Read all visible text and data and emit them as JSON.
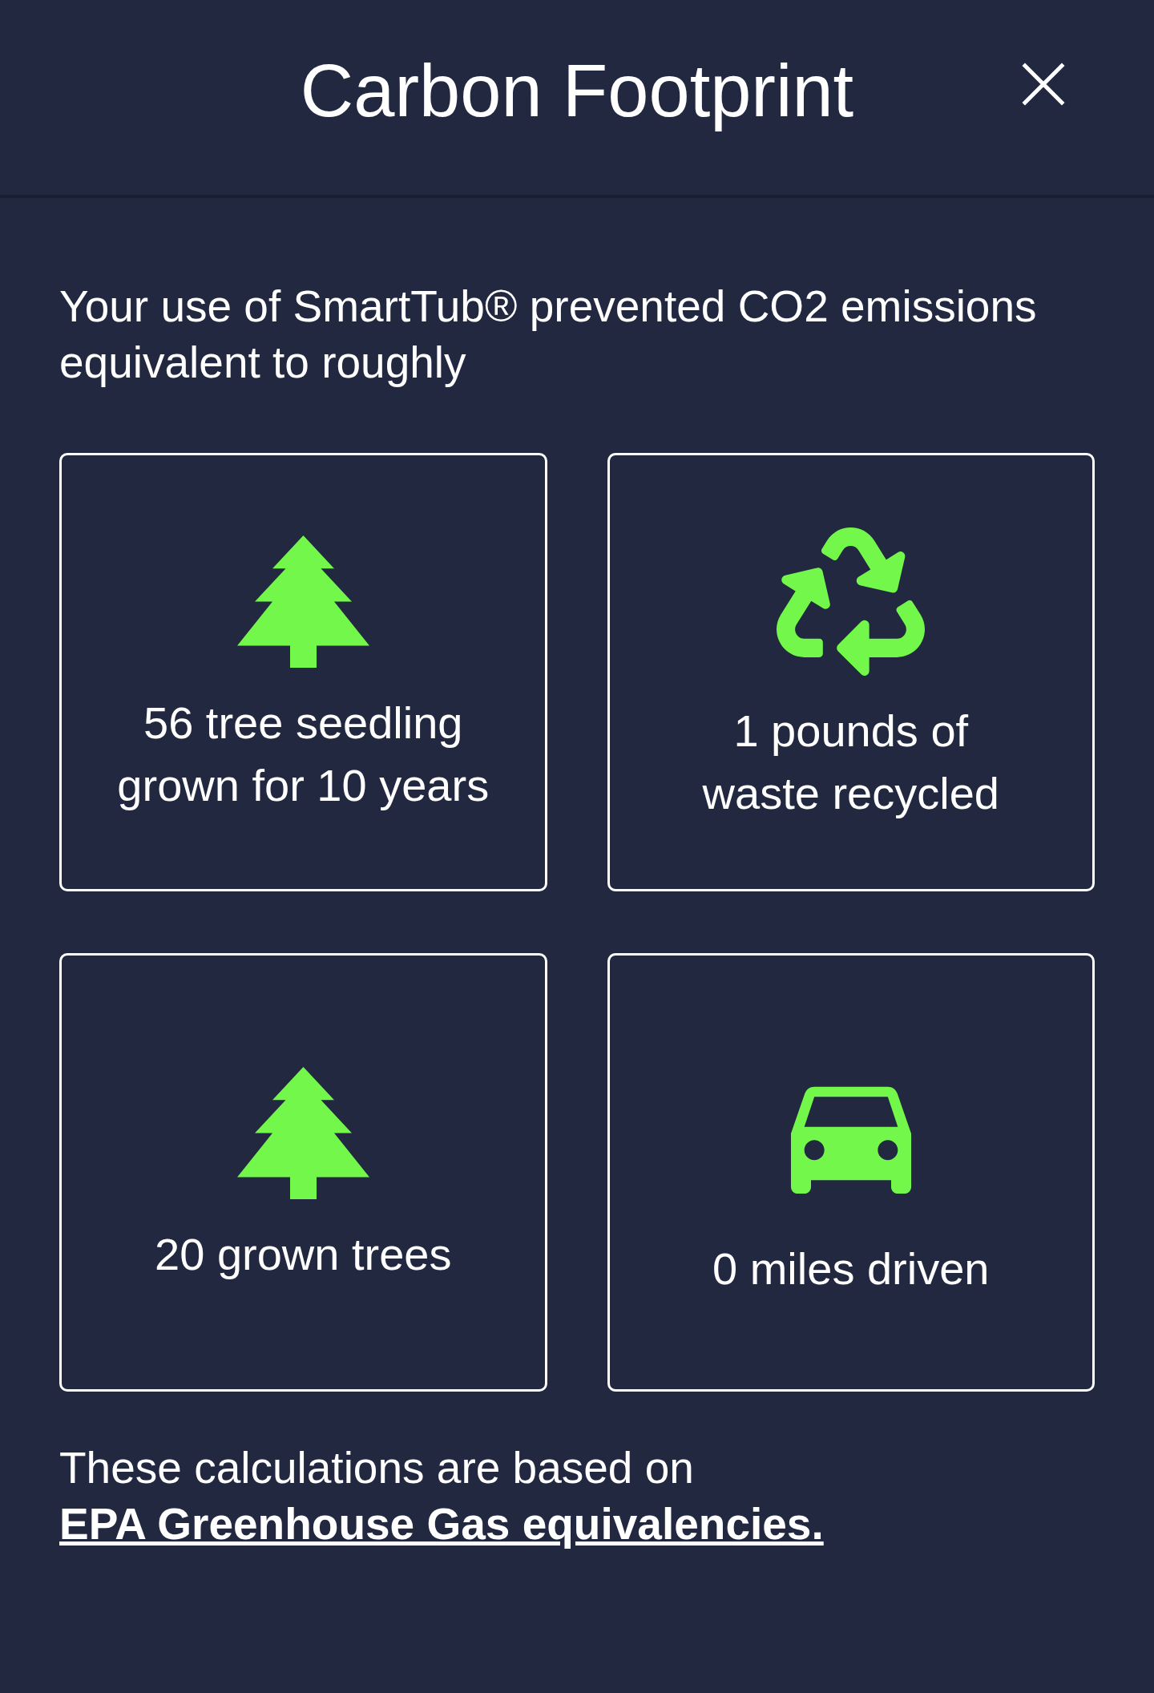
{
  "header": {
    "title": "Carbon Footprint"
  },
  "intro": "Your use of SmartTub® prevented CO2 emissions equivalent to roughly",
  "cards": [
    {
      "kind": "tree",
      "lines": [
        "56 tree seedling",
        "grown for 10 years"
      ]
    },
    {
      "kind": "recycle",
      "lines": [
        "1 pounds of",
        "waste recycled"
      ]
    },
    {
      "kind": "tree",
      "lines": [
        "20 grown trees"
      ]
    },
    {
      "kind": "car",
      "lines": [
        "0 miles driven"
      ]
    }
  ],
  "footer": {
    "text": "These calculations are based on",
    "link": "EPA Greenhouse Gas equivalencies."
  }
}
